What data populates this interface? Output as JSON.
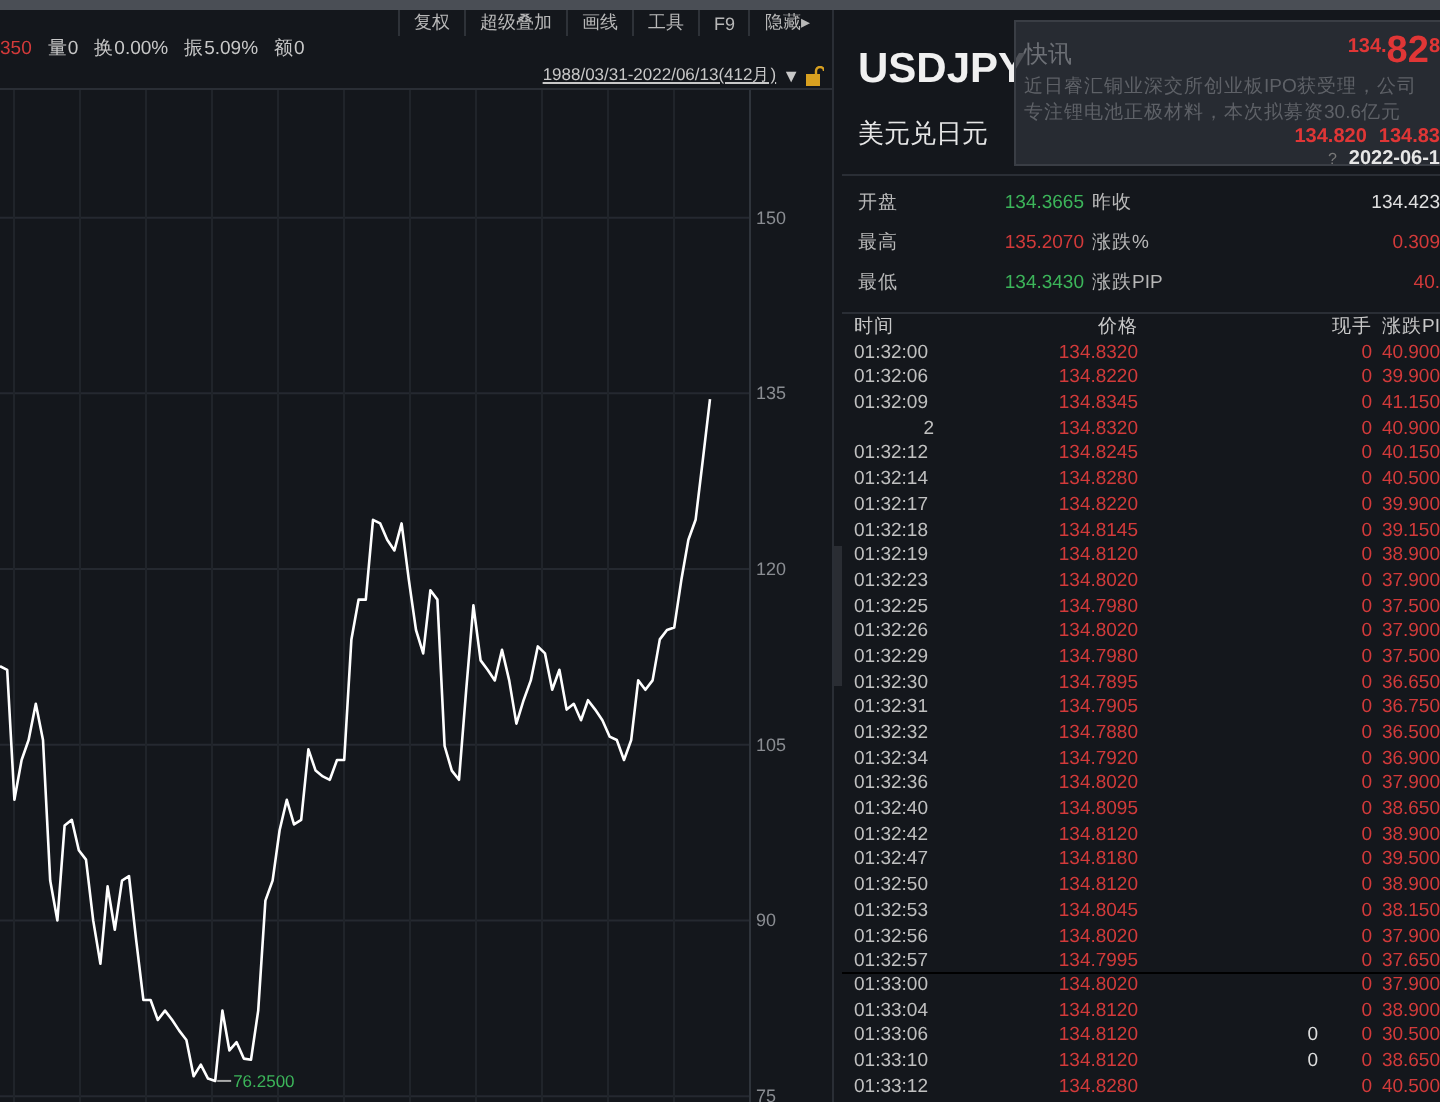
{
  "toolbar": {
    "buttons": [
      "复权",
      "超级叠加",
      "画线",
      "工具",
      "F9",
      "隐藏▸"
    ]
  },
  "stats_row": [
    {
      "text": "350",
      "color": "#d23a3a"
    },
    {
      "text": "量0",
      "color": "#c8c8c8"
    },
    {
      "text": "换0.00%",
      "color": "#c8c8c8"
    },
    {
      "text": "振5.09%",
      "color": "#c8c8c8"
    },
    {
      "text": "额0",
      "color": "#c8c8c8"
    }
  ],
  "range_link": "1988/03/31-2022/06/13(412月)",
  "range_caret": "▼",
  "chart": {
    "chart_data": {
      "type": "line",
      "grid": true,
      "ylim": [
        74.5,
        160.9
      ],
      "yticks": [
        75,
        90,
        105,
        120,
        135,
        150
      ],
      "annotations": [
        "76.2500"
      ],
      "series": [
        {
          "color": "#ffffff",
          "values": [
            111.7,
            111.4,
            100.3,
            103.7,
            105.4,
            108.5,
            105.4,
            93.4,
            90.0,
            98.1,
            98.6,
            96.0,
            95.2,
            90.0,
            86.3,
            92.9,
            89.2,
            93.4,
            93.8,
            88.3,
            83.2,
            83.2,
            81.5,
            82.3,
            81.5,
            80.6,
            79.8,
            76.7,
            77.7,
            76.5,
            76.3,
            82.3,
            78.9,
            79.6,
            78.2,
            78.1,
            82.3,
            91.7,
            93.4,
            97.7,
            100.3,
            98.2,
            98.6,
            104.6,
            102.8,
            102.3,
            102.0,
            103.7,
            103.7,
            114.0,
            117.4,
            117.4,
            124.2,
            123.9,
            122.5,
            121.6,
            123.9,
            119.1,
            114.8,
            112.8,
            118.2,
            117.4,
            104.9,
            102.8,
            102.0,
            109.7,
            116.9,
            112.2,
            111.4,
            110.5,
            113.1,
            110.5,
            106.8,
            108.8,
            110.5,
            113.4,
            112.8,
            109.7,
            111.4,
            108.0,
            108.5,
            107.1,
            108.8,
            108.0,
            107.1,
            105.7,
            105.4,
            103.7,
            105.4,
            110.5,
            109.7,
            110.5,
            114.0,
            114.8,
            115.0,
            119.1,
            122.5,
            124.2,
            129.3,
            134.5
          ]
        }
      ]
    }
  },
  "quote": {
    "symbol": "USDJPY",
    "name": "美元兑日元",
    "stats": [
      {
        "label": "开盘",
        "value": "134.3665",
        "color": "#3cb55a"
      },
      {
        "label": "昨收",
        "value": "134.423",
        "color": "#e0e0e0"
      },
      {
        "label": "最高",
        "value": "135.2070",
        "color": "#d23a3a"
      },
      {
        "label": "涨跌%",
        "value": "0.309",
        "color": "#d23a3a"
      },
      {
        "label": "最低",
        "value": "134.3430",
        "color": "#3cb55a"
      },
      {
        "label": "涨跌PIP",
        "value": "40.",
        "color": "#d23a3a"
      }
    ]
  },
  "popup": {
    "title": "快讯",
    "price_head": "134.",
    "price_big": "82",
    "price_tail": "8",
    "bid": "134.820",
    "ask": "134.83",
    "lines": [
      "近日睿汇铜业深交所创业板IPO获受理，公司",
      "专注锂电池正极材料，本次拟募资30.6亿元"
    ],
    "date": "2022-06-1",
    "marker": "?"
  },
  "ticks": {
    "columns": [
      "时间",
      "价格",
      "现手",
      "涨跌PI"
    ],
    "rows": [
      {
        "time": "01:32:00",
        "price": "134.8320",
        "vol": "0",
        "pip": "40.900"
      },
      {
        "time": "01:32:06",
        "price": "134.8220",
        "vol": "0",
        "pip": "39.900"
      },
      {
        "time": "01:32:09",
        "price": "134.8345",
        "vol": "0",
        "pip": "41.150"
      },
      {
        "time": "2",
        "price": "134.8320",
        "vol": "0",
        "pip": "40.900"
      },
      {
        "time": "01:32:12",
        "price": "134.8245",
        "vol": "0",
        "pip": "40.150"
      },
      {
        "time": "01:32:14",
        "price": "134.8280",
        "vol": "0",
        "pip": "40.500"
      },
      {
        "time": "01:32:17",
        "price": "134.8220",
        "vol": "0",
        "pip": "39.900"
      },
      {
        "time": "01:32:18",
        "price": "134.8145",
        "vol": "0",
        "pip": "39.150"
      },
      {
        "time": "01:32:19",
        "price": "134.8120",
        "vol": "0",
        "pip": "38.900"
      },
      {
        "time": "01:32:23",
        "price": "134.8020",
        "vol": "0",
        "pip": "37.900"
      },
      {
        "time": "01:32:25",
        "price": "134.7980",
        "vol": "0",
        "pip": "37.500"
      },
      {
        "time": "01:32:26",
        "price": "134.8020",
        "vol": "0",
        "pip": "37.900"
      },
      {
        "time": "01:32:29",
        "price": "134.7980",
        "vol": "0",
        "pip": "37.500"
      },
      {
        "time": "01:32:30",
        "price": "134.7895",
        "vol": "0",
        "pip": "36.650"
      },
      {
        "time": "01:32:31",
        "price": "134.7905",
        "vol": "0",
        "pip": "36.750"
      },
      {
        "time": "01:32:32",
        "price": "134.7880",
        "vol": "0",
        "pip": "36.500"
      },
      {
        "time": "01:32:34",
        "price": "134.7920",
        "vol": "0",
        "pip": "36.900"
      },
      {
        "time": "01:32:36",
        "price": "134.8020",
        "vol": "0",
        "pip": "37.900"
      },
      {
        "time": "01:32:40",
        "price": "134.8095",
        "vol": "0",
        "pip": "38.650"
      },
      {
        "time": "01:32:42",
        "price": "134.8120",
        "vol": "0",
        "pip": "38.900"
      },
      {
        "time": "01:32:47",
        "price": "134.8180",
        "vol": "0",
        "pip": "39.500"
      },
      {
        "time": "01:32:50",
        "price": "134.8120",
        "vol": "0",
        "pip": "38.900"
      },
      {
        "time": "01:32:53",
        "price": "134.8045",
        "vol": "0",
        "pip": "38.150"
      },
      {
        "time": "01:32:56",
        "price": "134.8020",
        "vol": "0",
        "pip": "37.900"
      },
      {
        "time": "01:32:57",
        "price": "134.7995",
        "vol": "0",
        "pip": "37.650"
      },
      {
        "time": "01:33:00",
        "price": "134.8020",
        "vol": "0",
        "pip": "37.900",
        "new_minute": true
      },
      {
        "time": "01:33:04",
        "price": "134.8120",
        "vol": "0",
        "pip": "38.900"
      },
      {
        "time": "01:33:06",
        "price": "134.8120",
        "vol": "0",
        "pip": "30.500",
        "extra": "0"
      },
      {
        "time": "01:33:10",
        "price": "134.8120",
        "vol": "0",
        "pip": "38.650",
        "extra": "0"
      },
      {
        "time": "01:33:12",
        "price": "134.8280",
        "vol": "0",
        "pip": "40.500"
      }
    ]
  }
}
